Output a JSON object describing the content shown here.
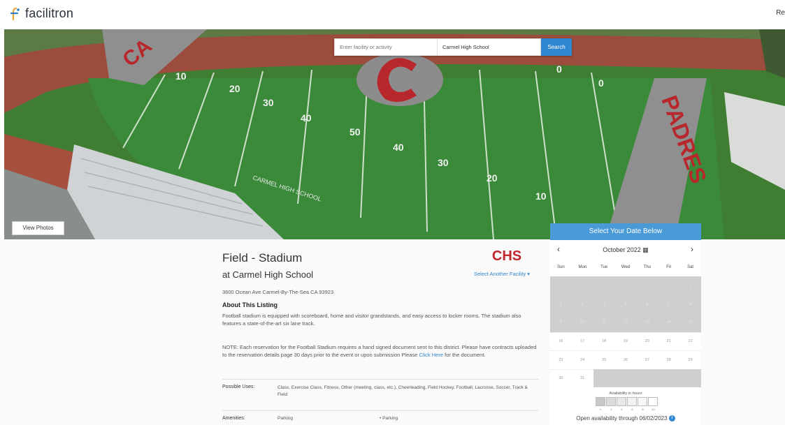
{
  "header": {
    "logo_text": "facilitron",
    "right_text": "Re"
  },
  "search": {
    "activity_placeholder": "Enter facility or activity",
    "school_value": "Carmel High School",
    "button_label": "Search"
  },
  "hero": {
    "view_photos_label": "View Photos"
  },
  "listing": {
    "title": "Field - Stadium",
    "subtitle": "at Carmel High School",
    "address": "3600 Ocean Ave Carmel-By-The-Sea CA 93923",
    "about_heading": "About This Listing",
    "about_text": "Football stadium is equipped with scoreboard, home and visitor grandstands, and easy access to locker rooms. The stadium also features a state-of-the-art six lane track.",
    "note_text": "NOTE: Each reservation for the Football Stadium requires a hand signed document sent to this district. Please have contracts uploaded to the reservation details page 30 days prior to the event or upon submission Please",
    "note_link": "Click Here",
    "note_suffix": "for the document.",
    "uses_label": "Possible Uses:",
    "uses_text": "Class,   Exercise Class,   Fitness,   Other (meeting, class, etc.),   Cheerleading,   Field Hockey,   Football,   Lacrosse,   Soccer,   Track & Field",
    "amenities_label": "Amenities:",
    "amenity_1": "Parking",
    "amenity_2": "• Parking",
    "select_another": "Select Another Facility ▾",
    "school_logo_text": "CHS"
  },
  "calendar": {
    "header": "Select Your Date Below",
    "month": "October 2022",
    "prev": "‹",
    "next": "›",
    "days": [
      "Sun",
      "Mon",
      "Tue",
      "Wed",
      "Thu",
      "Fri",
      "Sat"
    ],
    "weeks": [
      [
        "",
        "",
        "",
        "",
        "",
        "",
        "1"
      ],
      [
        "2",
        "3",
        "4",
        "5",
        "6",
        "7",
        "8"
      ],
      [
        "9",
        "10",
        "11",
        "12",
        "13",
        "14",
        "15"
      ],
      [
        "16",
        "17",
        "18",
        "19",
        "20",
        "21",
        "22"
      ],
      [
        "23",
        "24",
        "25",
        "26",
        "27",
        "28",
        "29"
      ],
      [
        "30",
        "31",
        "",
        "",
        "",
        "",
        ""
      ]
    ],
    "availability_label": "Availability in hours",
    "availability_scale": [
      "1-",
      "2",
      "4",
      "6",
      "8",
      "10"
    ],
    "open_text": "Open availability through 06/02/2023",
    "colors": {
      "header": "#4a9ad8",
      "unavailable": "#cfcfcf"
    }
  },
  "colors": {
    "accent": "#2f86d1"
  }
}
